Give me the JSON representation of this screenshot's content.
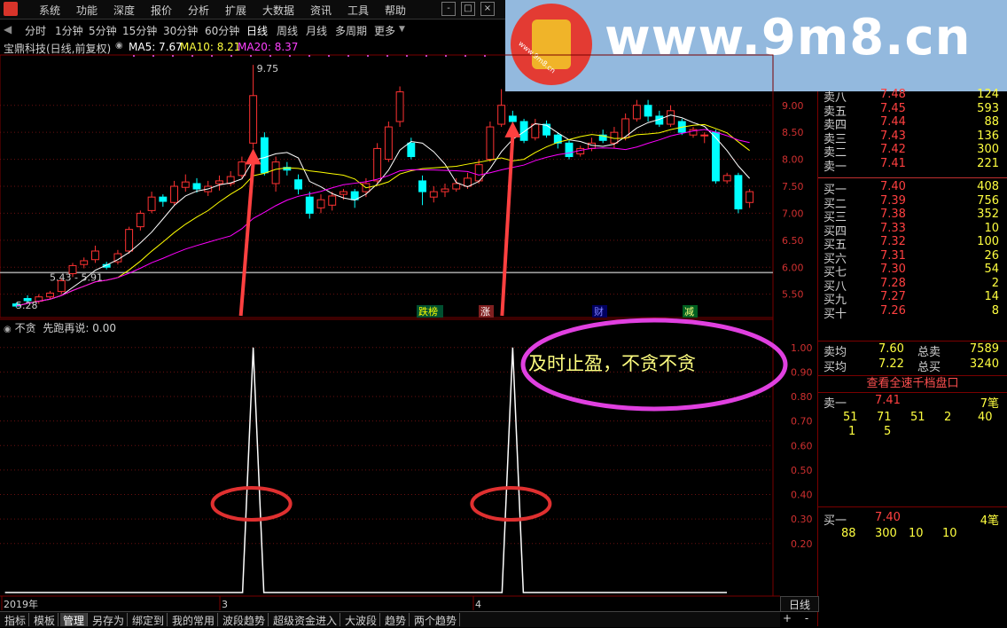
{
  "menu": {
    "items": [
      "系统",
      "功能",
      "深度",
      "报价",
      "分析",
      "扩展",
      "大数据",
      "资讯",
      "工具",
      "帮助"
    ]
  },
  "window_controls": [
    "-",
    "□",
    "×"
  ],
  "periods": {
    "items": [
      "分时",
      "1分钟",
      "5分钟",
      "15分钟",
      "30分钟",
      "60分钟",
      "日线",
      "周线",
      "月线",
      "多周期",
      "更多"
    ],
    "active": "日线"
  },
  "stock": {
    "name": "宝鼎科技(日线,前复权)",
    "ma5": "MA5: 7.67",
    "ma10": "MA10: 8.21",
    "ma20": "MA20: 8.37"
  },
  "banner": {
    "url": "www.9m8.cn",
    "small_url": "www.9m8.cn"
  },
  "chart_data": [
    {
      "type": "candlestick",
      "title": "宝鼎科技(日线,前复权)",
      "y_ticks": [
        9.0,
        8.5,
        8.0,
        7.5,
        7.0,
        6.5,
        6.0,
        5.5
      ],
      "ylim": [
        5.1,
        9.9
      ],
      "x_labels": [
        "2019年",
        "3",
        "4"
      ],
      "annotations": {
        "high": "9.75",
        "low": "5.28",
        "range": "5.43 - 5.91",
        "hline": 5.9
      },
      "signals": [
        "跌榜",
        "涨",
        "财",
        "减"
      ],
      "candles": [
        [
          5.32,
          5.28,
          5.35,
          5.25
        ],
        [
          5.42,
          5.38,
          5.48,
          5.33
        ],
        [
          5.37,
          5.45,
          5.5,
          5.32
        ],
        [
          5.45,
          5.52,
          5.56,
          5.42
        ],
        [
          5.55,
          5.75,
          5.8,
          5.5
        ],
        [
          5.88,
          6.03,
          6.08,
          5.82
        ],
        [
          6.05,
          6.12,
          6.18,
          5.98
        ],
        [
          6.14,
          6.3,
          6.4,
          6.08
        ],
        [
          6.05,
          6.0,
          6.1,
          5.96
        ],
        [
          6.1,
          6.25,
          6.32,
          6.05
        ],
        [
          6.3,
          6.7,
          6.75,
          6.25
        ],
        [
          6.75,
          7.0,
          7.05,
          6.68
        ],
        [
          7.05,
          7.3,
          7.4,
          7.0
        ],
        [
          7.3,
          7.22,
          7.35,
          7.12
        ],
        [
          7.2,
          7.5,
          7.6,
          7.15
        ],
        [
          7.48,
          7.58,
          7.72,
          7.4
        ],
        [
          7.55,
          7.45,
          7.65,
          7.38
        ],
        [
          7.4,
          7.5,
          7.6,
          7.32
        ],
        [
          7.55,
          7.6,
          7.7,
          7.42
        ],
        [
          7.55,
          7.68,
          7.78,
          7.5
        ],
        [
          7.7,
          7.95,
          8.05,
          7.65
        ],
        [
          8.3,
          9.18,
          9.75,
          8.2
        ],
        [
          8.4,
          7.75,
          8.5,
          7.7
        ],
        [
          7.55,
          7.95,
          8.05,
          7.4
        ],
        [
          7.85,
          7.8,
          7.95,
          7.7
        ],
        [
          7.62,
          7.45,
          7.72,
          7.35
        ],
        [
          7.3,
          7.0,
          7.4,
          6.9
        ],
        [
          7.1,
          7.25,
          7.35,
          7.0
        ],
        [
          7.15,
          7.32,
          7.4,
          7.05
        ],
        [
          7.35,
          7.4,
          7.45,
          7.25
        ],
        [
          7.4,
          7.25,
          7.45,
          7.1
        ],
        [
          7.4,
          7.55,
          7.65,
          7.3
        ],
        [
          7.6,
          8.2,
          8.3,
          7.55
        ],
        [
          8.0,
          8.6,
          8.7,
          7.95
        ],
        [
          8.7,
          9.25,
          9.35,
          8.6
        ],
        [
          8.3,
          8.05,
          8.4,
          8.0
        ],
        [
          7.6,
          7.4,
          7.7,
          7.15
        ],
        [
          7.3,
          7.4,
          7.5,
          7.2
        ],
        [
          7.4,
          7.45,
          7.55,
          7.3
        ],
        [
          7.45,
          7.55,
          7.65,
          7.4
        ],
        [
          7.5,
          7.65,
          7.75,
          7.45
        ],
        [
          7.6,
          7.9,
          8.0,
          7.55
        ],
        [
          8.0,
          8.6,
          8.7,
          7.95
        ],
        [
          8.65,
          9.0,
          9.3,
          8.6
        ],
        [
          8.8,
          8.7,
          8.9,
          8.55
        ],
        [
          8.7,
          8.35,
          8.75,
          8.3
        ],
        [
          8.4,
          8.65,
          8.75,
          8.35
        ],
        [
          8.65,
          8.45,
          8.72,
          8.4
        ],
        [
          8.45,
          8.3,
          8.5,
          8.2
        ],
        [
          8.3,
          8.05,
          8.35,
          8.0
        ],
        [
          8.1,
          8.2,
          8.25,
          8.05
        ],
        [
          8.2,
          8.3,
          8.4,
          8.15
        ],
        [
          8.45,
          8.35,
          8.55,
          8.3
        ],
        [
          8.3,
          8.5,
          8.6,
          8.2
        ],
        [
          8.4,
          8.75,
          8.85,
          8.35
        ],
        [
          8.75,
          9.0,
          9.1,
          8.7
        ],
        [
          9.0,
          8.8,
          9.1,
          8.7
        ],
        [
          8.8,
          8.65,
          8.9,
          8.6
        ],
        [
          8.65,
          8.9,
          9.0,
          8.6
        ],
        [
          8.7,
          8.5,
          8.75,
          8.45
        ],
        [
          8.45,
          8.55,
          8.6,
          8.4
        ],
        [
          8.45,
          8.45,
          8.5,
          8.3
        ],
        [
          8.5,
          7.6,
          8.55,
          7.55
        ],
        [
          7.6,
          7.7,
          7.75,
          7.55
        ],
        [
          7.7,
          7.08,
          7.75,
          7.0
        ],
        [
          7.2,
          7.4,
          7.45,
          7.1
        ]
      ]
    },
    {
      "type": "line",
      "title": "不贪",
      "subtitle": "先跑再说: 0.00",
      "y_ticks": [
        1.0,
        0.9,
        0.8,
        0.7,
        0.6,
        0.5,
        0.4,
        0.3,
        0.2
      ],
      "ylim": [
        0,
        1.05
      ],
      "series": [
        {
          "values_note": "",
          "spikes": [
            21,
            44
          ]
        }
      ]
    }
  ],
  "overlay_text": {
    "callout": "及时止盈，不贪不贪"
  },
  "orderbook": {
    "asks": [
      [
        "卖八",
        "7.48",
        "124"
      ],
      [
        "卖五",
        "7.45",
        "593"
      ],
      [
        "卖四",
        "7.44",
        "88"
      ],
      [
        "卖三",
        "7.43",
        "136"
      ],
      [
        "卖二",
        "7.42",
        "300"
      ],
      [
        "卖一",
        "7.41",
        "221"
      ]
    ],
    "bids": [
      [
        "买一",
        "7.40",
        "408"
      ],
      [
        "买二",
        "7.39",
        "756"
      ],
      [
        "买三",
        "7.38",
        "352"
      ],
      [
        "买四",
        "7.33",
        "10"
      ],
      [
        "买五",
        "7.32",
        "100"
      ],
      [
        "买六",
        "7.31",
        "26"
      ],
      [
        "买七",
        "7.30",
        "54"
      ],
      [
        "买八",
        "7.28",
        "2"
      ],
      [
        "买九",
        "7.27",
        "14"
      ],
      [
        "买十",
        "7.26",
        "8"
      ]
    ],
    "summary": [
      [
        "卖均",
        "7.60",
        "总卖",
        "7589"
      ],
      [
        "买均",
        "7.22",
        "总买",
        "3240"
      ]
    ],
    "full_depth_button": "查看全速千档盘口",
    "ask1": {
      "label": "卖一",
      "price": "7.41",
      "count": "7笔",
      "queue1": [
        "51",
        "71",
        "51",
        "2",
        "40"
      ],
      "queue2": [
        "1",
        "5"
      ]
    },
    "bid1": {
      "label": "买一",
      "price": "7.40",
      "count": "4笔",
      "queue": [
        "88",
        "300",
        "10",
        "10"
      ]
    }
  },
  "bottom_tabs": [
    "指标",
    "模板",
    "管理",
    "另存为",
    "绑定到",
    "我的常用",
    "波段趋势",
    "超级资金进入",
    "大波段",
    "趋势",
    "两个趋势"
  ],
  "bottom_active": "管理",
  "bottom_right": {
    "period": "日线",
    "plus": "+",
    "minus": "-"
  },
  "colors": {
    "up": "#ff3232",
    "down": "#00ffff",
    "ma5": "#ffffff",
    "ma10": "#ffff00",
    "ma20": "#ff00ff",
    "oval": "#e040e0",
    "redring": "#e03030"
  }
}
